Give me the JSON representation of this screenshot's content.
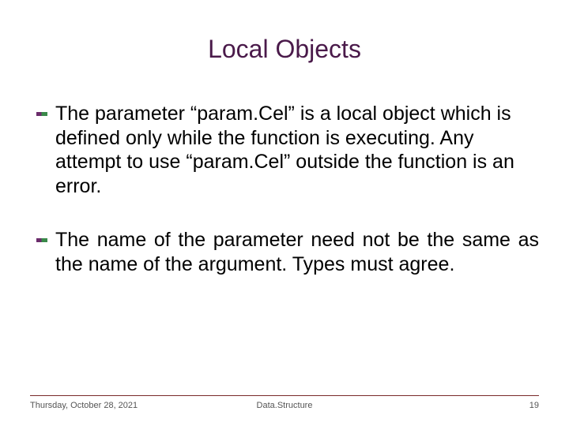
{
  "slide": {
    "title": "Local Objects",
    "bullets": [
      "The parameter “param.Cel” is a local object which is defined only while the function is executing.  Any attempt to use “param.Cel” outside the function is an error.",
      "The name of the parameter need not be the same as the name of the argument.  Types must agree."
    ]
  },
  "footer": {
    "date": "Thursday, October 28, 2021",
    "center": "Data.Structure",
    "page": "19"
  }
}
